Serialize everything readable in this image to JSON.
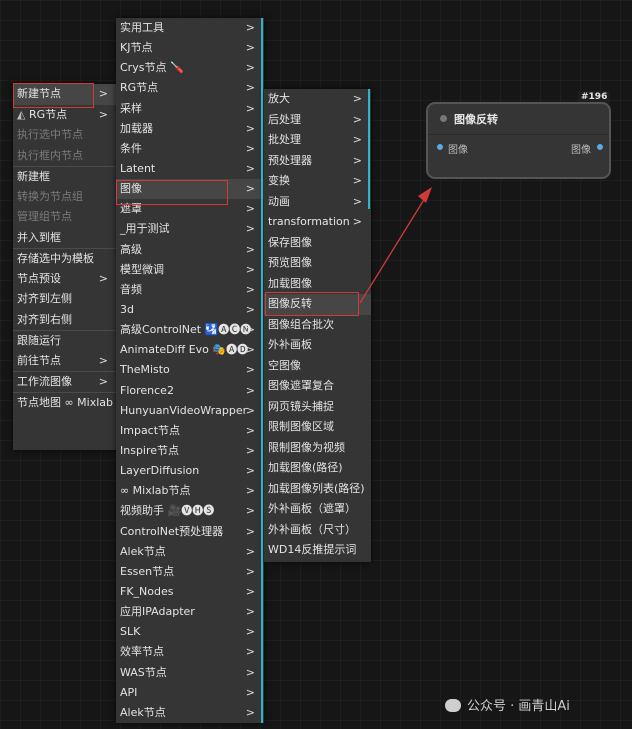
{
  "menu1": [
    {
      "label": "新建节点",
      "arrow": true
    },
    {
      "label": "RG节点",
      "arrow": true,
      "icon": "rg-logo-icon"
    },
    {
      "label": "执行选中节点",
      "disabled": true
    },
    {
      "label": "执行框内节点",
      "disabled": true
    },
    {
      "label": "新建框",
      "sep": true
    },
    {
      "label": "转换为节点组",
      "disabled": true
    },
    {
      "label": "管理组节点",
      "disabled": true
    },
    {
      "label": "并入到框"
    },
    {
      "label": "存储选中为模板",
      "sep": true
    },
    {
      "label": "节点预设",
      "arrow": true
    },
    {
      "label": "对齐到左侧"
    },
    {
      "label": "对齐到右侧"
    },
    {
      "label": "跟随运行",
      "sep": true
    },
    {
      "label": "前往节点",
      "arrow": true
    },
    {
      "label": "工作流图像",
      "arrow": true,
      "sep": true
    },
    {
      "label": "节点地图 ∞ Mixlab",
      "sep": true
    }
  ],
  "menu2": [
    {
      "label": "实用工具"
    },
    {
      "label": "KJ节点"
    },
    {
      "label": "Crys节点 🪛"
    },
    {
      "label": "RG节点"
    },
    {
      "label": "采样"
    },
    {
      "label": "加载器"
    },
    {
      "label": "条件"
    },
    {
      "label": "Latent"
    },
    {
      "label": "图像"
    },
    {
      "label": "遮罩"
    },
    {
      "label": "_用于测试"
    },
    {
      "label": "高级"
    },
    {
      "label": "模型微调"
    },
    {
      "label": "音频"
    },
    {
      "label": "3d"
    },
    {
      "label": "高级ControlNet 🛂🅐🅒🅝"
    },
    {
      "label": "AnimateDiff Evo 🎭🅐🅓"
    },
    {
      "label": "TheMisto"
    },
    {
      "label": "Florence2"
    },
    {
      "label": "HunyuanVideoWrapper"
    },
    {
      "label": "Impact节点"
    },
    {
      "label": "Inspire节点"
    },
    {
      "label": "LayerDiffusion"
    },
    {
      "label": "∞ Mixlab节点"
    },
    {
      "label": "视频助手 🎥🅥🅗🅢"
    },
    {
      "label": "ControlNet预处理器"
    },
    {
      "label": "Alek节点"
    },
    {
      "label": "Essen节点"
    },
    {
      "label": "FK_Nodes"
    },
    {
      "label": "应用IPAdapter"
    },
    {
      "label": "SLK"
    },
    {
      "label": "效率节点"
    },
    {
      "label": "WAS节点"
    },
    {
      "label": "API"
    },
    {
      "label": "Alek节点"
    }
  ],
  "menu3": [
    {
      "label": "放大",
      "arrow": true
    },
    {
      "label": "后处理",
      "arrow": true
    },
    {
      "label": "批处理",
      "arrow": true
    },
    {
      "label": "预处理器",
      "arrow": true
    },
    {
      "label": "变换",
      "arrow": true
    },
    {
      "label": "动画",
      "arrow": true
    },
    {
      "label": "transformation",
      "arrow": true
    },
    {
      "label": "保存图像"
    },
    {
      "label": "预览图像"
    },
    {
      "label": "加载图像"
    },
    {
      "label": "图像反转"
    },
    {
      "label": "图像组合批次"
    },
    {
      "label": "外补画板"
    },
    {
      "label": "空图像"
    },
    {
      "label": "图像遮罩复合"
    },
    {
      "label": "网页镜头捕捉"
    },
    {
      "label": "限制图像区域"
    },
    {
      "label": "限制图像为视频"
    },
    {
      "label": "加载图像(路径)"
    },
    {
      "label": "加载图像列表(路径)"
    },
    {
      "label": "外补画板（遮罩）"
    },
    {
      "label": "外补画板（尺寸）"
    },
    {
      "label": "WD14反推提示词"
    }
  ],
  "node": {
    "badge": "#196",
    "title": "图像反转",
    "input": "图像",
    "output": "图像",
    "port_color": "#5aa8e8"
  },
  "watermark": "公众号 · 画青山Ai",
  "colors": {
    "highlight_box": "#d23a3a",
    "arrow": "#d23a3a",
    "accent_bar": "#2db5c8"
  }
}
